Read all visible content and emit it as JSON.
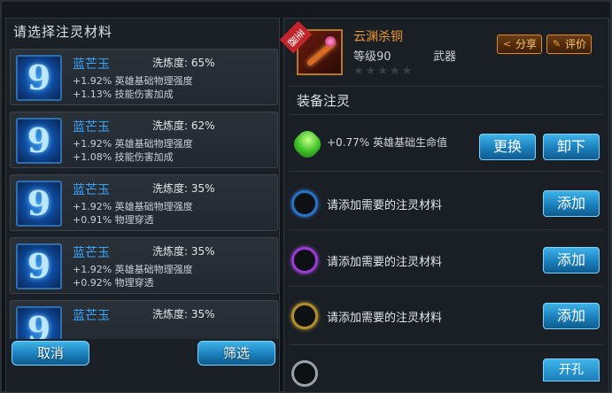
{
  "left_panel": {
    "title": "请选择注灵材料",
    "items": [
      {
        "name": "蓝芒玉",
        "refine": "洗炼度: 65%",
        "stat1": "+1.92% 英雄基础物理强度",
        "stat2": "+1.13% 技能伤害加成"
      },
      {
        "name": "蓝芒玉",
        "refine": "洗炼度: 62%",
        "stat1": "+1.92% 英雄基础物理强度",
        "stat2": "+1.08% 技能伤害加成"
      },
      {
        "name": "蓝芒玉",
        "refine": "洗炼度: 35%",
        "stat1": "+1.92% 英雄基础物理强度",
        "stat2": "+0.91% 物理穿透"
      },
      {
        "name": "蓝芒玉",
        "refine": "洗炼度: 35%",
        "stat1": "+1.92% 英雄基础物理强度",
        "stat2": "+0.92% 物理穿透"
      },
      {
        "name": "蓝芒玉",
        "refine": "洗炼度: 35%",
        "stat1": "",
        "stat2": ""
      }
    ],
    "cancel_label": "取消",
    "filter_label": "筛选"
  },
  "right_panel": {
    "badge": "圣器",
    "weapon_name": "云渊杀铜",
    "level": "等级90",
    "type": "武器",
    "stars": "★★★★★",
    "share_label": "分享",
    "review_label": "评价",
    "section_title": "装备注灵",
    "slot1_stat": "+0.77% 英雄基础生命值",
    "replace_label": "更换",
    "unload_label": "卸下",
    "empty_slot_text": "请添加需要的注灵材料",
    "add_label": "添加",
    "partial_button": "开孔"
  },
  "colors": {
    "material_name": "#37a6ff",
    "weapon_name": "#e8962e",
    "button_blue": "#1a7fbb",
    "button_orange": "#e18a2a"
  },
  "icons": {
    "share": "share-icon",
    "review": "edit-icon",
    "material": "blue-gem-icon"
  }
}
